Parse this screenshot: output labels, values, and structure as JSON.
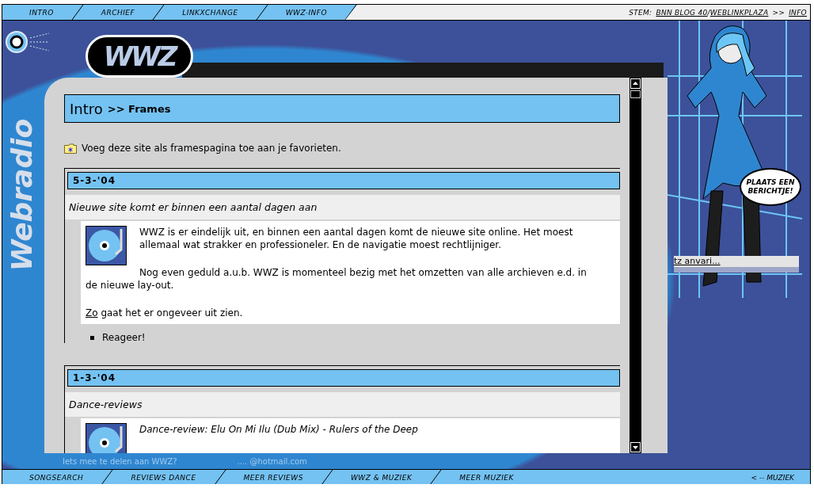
{
  "top_nav": {
    "links": [
      {
        "label": "INTRO"
      },
      {
        "label": "ARCHIEF"
      },
      {
        "label": "LINKXCHANGE"
      },
      {
        "label": "WWZ-INFO"
      }
    ],
    "vote": {
      "label": "STEM:",
      "links": [
        "BNN BLOG 40",
        "WEBLINKPLAZA"
      ],
      "separator": "/",
      "arrow": ">>",
      "info": "INFO"
    }
  },
  "sidebar": {
    "title": "Webradio"
  },
  "logo": {
    "text": "WWZ"
  },
  "page_heading": {
    "title": "Intro",
    "crumb": ">> Frames"
  },
  "favorite_link": "Voeg deze site als framespagina toe aan je favorieten.",
  "posts": [
    {
      "date": "5-3-'04",
      "title": "Nieuwe site komt er binnen een aantal dagen aan",
      "paragraphs": [
        {
          "kind": "text",
          "text": "WWZ is er eindelijk uit, en binnen een aantal dagen komt de nieuwe site online. Het moest allemaal wat strakker en professioneler. En de navigatie moest rechtlijniger."
        },
        {
          "kind": "text",
          "text": "Nog even geduld a.u.b. WWZ is momenteel bezig met het omzetten van alle archieven e.d. in de nieuwe lay-out."
        },
        {
          "kind": "link",
          "link": "Zo",
          "text": " gaat het er ongeveer uit zien."
        }
      ],
      "actions": [
        "Reageer!"
      ]
    },
    {
      "date": "1-3-'04",
      "title": "Dance-reviews",
      "paragraphs": [
        {
          "kind": "italic",
          "text": "Dance-review: Elu On Mi Ilu (Dub Mix) - Rulers of the Deep"
        }
      ]
    }
  ],
  "bubble": "PLAATS EEN BERICHTJE!",
  "shoutbox": {
    "entry": "tz anvari..."
  },
  "footer": {
    "question": "Iets mee te delen aan WWZ?",
    "email": ".... @hotmail.com"
  },
  "bottom_nav": {
    "links": [
      {
        "label": "SONGSEARCH"
      },
      {
        "label": "REVIEWS DANCE"
      },
      {
        "label": "MEER REVIEWS"
      },
      {
        "label": "WWZ & MUZIEK"
      },
      {
        "label": "MEER MUZIEK"
      }
    ],
    "back": "< -- MUZIEK"
  }
}
